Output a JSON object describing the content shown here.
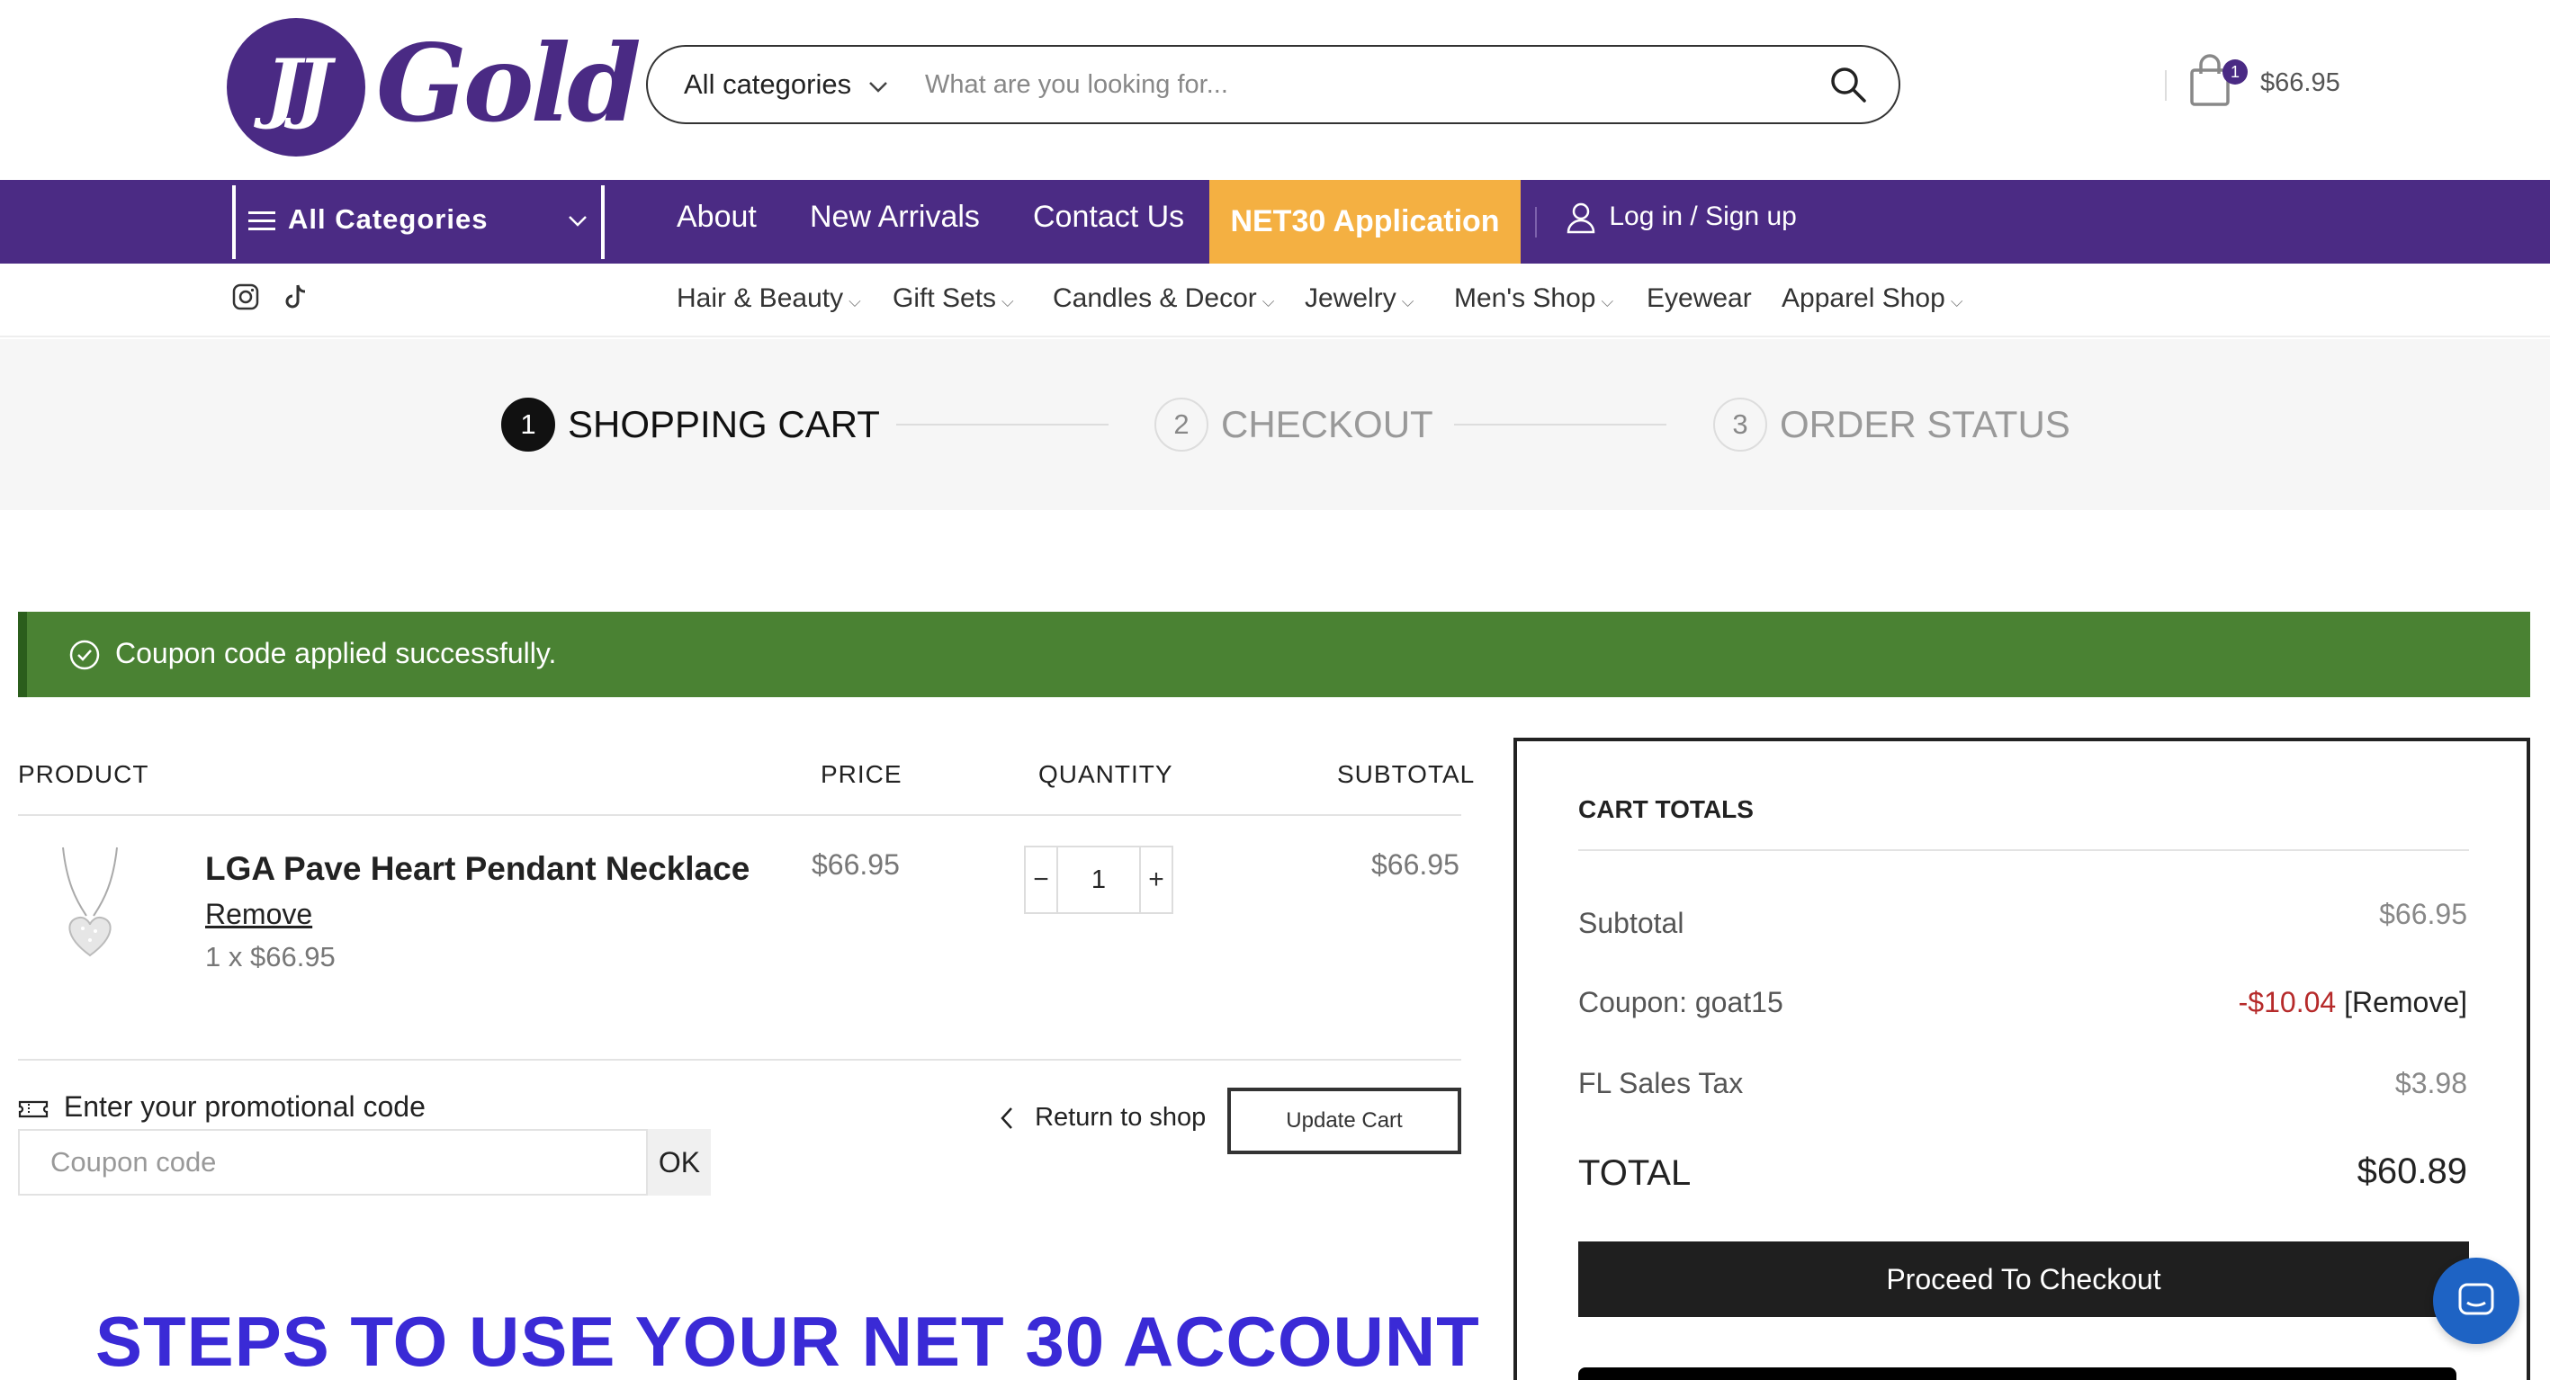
{
  "header": {
    "logo_mark": "JJ",
    "logo_text": "Gold",
    "search": {
      "category": "All categories",
      "placeholder": "What are you looking for..."
    },
    "cart": {
      "badge": "1",
      "total": "$66.95"
    }
  },
  "nav": {
    "all_categories": "All Categories",
    "links": [
      "About",
      "New Arrivals",
      "Contact Us"
    ],
    "net30": "NET30 Application",
    "login": "Log in / Sign up"
  },
  "subnav": {
    "items": [
      "Hair & Beauty",
      "Gift Sets",
      "Candles & Decor",
      "Jewelry",
      "Men's Shop",
      "Eyewear",
      "Apparel Shop"
    ]
  },
  "steps": [
    {
      "num": "1",
      "label": "SHOPPING CART"
    },
    {
      "num": "2",
      "label": "CHECKOUT"
    },
    {
      "num": "3",
      "label": "ORDER STATUS"
    }
  ],
  "notice": "Coupon code applied successfully.",
  "cart_table": {
    "headers": [
      "PRODUCT",
      "PRICE",
      "QUANTITY",
      "SUBTOTAL"
    ],
    "rows": [
      {
        "name": "LGA Pave Heart Pendant Necklace",
        "remove": "Remove",
        "qty_note": "1 x $66.95",
        "price": "$66.95",
        "qty": "1",
        "subtotal": "$66.95"
      }
    ],
    "promo_label": "Enter your promotional code",
    "coupon_placeholder": "Coupon code",
    "ok": "OK",
    "return": "Return to shop",
    "update": "Update Cart"
  },
  "totals": {
    "title": "CART TOTALS",
    "subtotal_label": "Subtotal",
    "subtotal": "$66.95",
    "coupon_label": "Coupon: goat15",
    "coupon_amount": "-$10.04",
    "coupon_remove": "[Remove]",
    "tax_label": "FL Sales Tax",
    "tax": "$3.98",
    "total_label": "TOTAL",
    "total": "$60.89",
    "checkout": "Proceed To Checkout"
  },
  "banner": "STEPS TO USE YOUR NET 30 ACCOUNT",
  "colors": {
    "brand_purple": "#4b2b84",
    "net30_orange": "#f4b042",
    "success_green": "#4a8233",
    "discount_red": "#b62a2a",
    "banner_blue": "#3a2ad6"
  }
}
